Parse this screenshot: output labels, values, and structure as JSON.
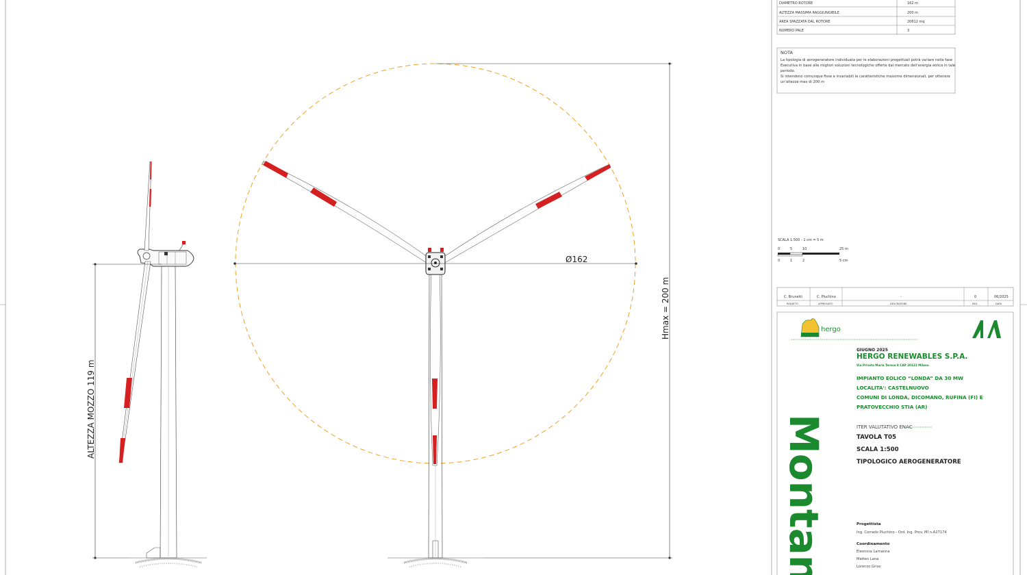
{
  "specs_table": [
    {
      "label": "DIAMETRO ROTORE",
      "value": "162 m"
    },
    {
      "label": "ALTEZZA MASSIMA RAGGIUNGIBILE",
      "value": "200 m"
    },
    {
      "label": "AREA SPAZZATA DAL ROTORE",
      "value": "20612 mq"
    },
    {
      "label": "NUMERO PALE",
      "value": "3"
    }
  ],
  "note": {
    "title": "NOTA",
    "lines": [
      "La tipologia di aerogeneratore individuata per le elaborazioni progettuali potrà variare nella fase",
      "Esecutiva in base alle migliori soluzioni tecnologiche offerte dal mercato dell'energia eolica in tale",
      "periodo.",
      "Si intendono comunque fisse e invariabili le caratteristiche massime dimensionali, per ottenere",
      "un'altezza max di 200 m"
    ]
  },
  "scale_bar": {
    "title": "SCALA 1:500 - 1 cm = 5 m",
    "top_labels": [
      "0",
      "5",
      "10",
      "25 m"
    ],
    "bottom_labels": [
      "0",
      "1",
      "2",
      "5 cm"
    ]
  },
  "revision": {
    "row": [
      "C. Brunetti",
      "C. Pluchino",
      "-",
      "0",
      "06/2025"
    ],
    "headers": [
      "REDATTO",
      "APPROVATO",
      "DESCRIZIONE",
      "REV.",
      "DATA"
    ]
  },
  "dimensions": {
    "rotor_diameter": "Ø162",
    "hmax": "Hmax = 200 m",
    "hub_height": "ALTEZZA MOZZO 119 m"
  },
  "title_block": {
    "logo_text": "hergo",
    "vertical_brand": "Montan",
    "date": "GIUGNO 2025",
    "company": "HERGO RENEWABLES S.P.A.",
    "address": "Via Privata Maria Teresa 8 CAP 20123 Milano",
    "project_lines": [
      "IMPIANTO EOLICO “LONDA” DA 30 MW",
      "LOCALITA': CASTELNUOVO",
      "COMUNI DI LONDA, DICOMANO, RUFINA (FI) E",
      "PRATOVECCHIO STIA (AR)"
    ],
    "iter": "ITER VALUTATIVO ENAC",
    "tavola": "TAVOLA T05",
    "scala": "SCALA   1:500",
    "subject": "TIPOLOGICO AEROGENERATORE",
    "progettista_label": "Progettista",
    "progettista": "Ing. Corrado Pluchino - Ord. Ing. Prov. MI n.A27174",
    "coordinamento_label": "Coordinamento",
    "coordinamento": [
      "Eleonora Lamanna",
      "Matteo Lana",
      "Lorenzo Griso"
    ]
  },
  "colors": {
    "blade_band": "#d42020",
    "rotor_circle": "#f0a020",
    "brand_green": "#1b8a2e"
  }
}
